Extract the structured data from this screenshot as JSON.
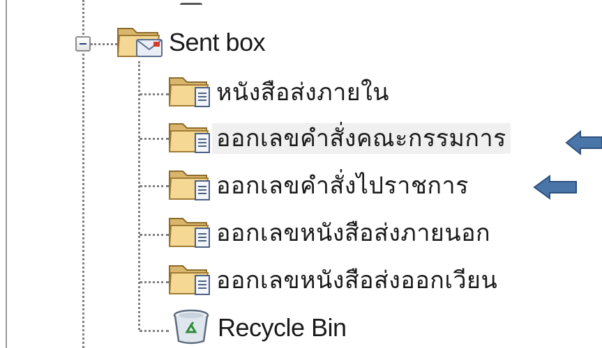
{
  "tree": {
    "parent": {
      "label": "Sent box",
      "icon": "sent-box-folder-icon",
      "expanded": true
    },
    "children": [
      {
        "label": "หนังสือส่งภายใน",
        "icon": "folder-document-icon",
        "highlighted": false
      },
      {
        "label": "ออกเลขคำสั่งคณะกรรมการ",
        "icon": "folder-document-icon",
        "highlighted": true
      },
      {
        "label": "ออกเลขคำสั่งไปราชการ",
        "icon": "folder-document-icon",
        "highlighted": false
      },
      {
        "label": "ออกเลขหนังสือส่งภายนอก",
        "icon": "folder-document-icon",
        "highlighted": false
      },
      {
        "label": "ออกเลขหนังสือส่งออกเวียน",
        "icon": "folder-document-icon",
        "highlighted": false
      }
    ],
    "recycle_bin": {
      "label": "Recycle Bin",
      "icon": "recycle-bin-icon"
    }
  },
  "annotations": {
    "arrow_color": "#4a75a8",
    "arrow_outline": "#2c4f7c"
  }
}
